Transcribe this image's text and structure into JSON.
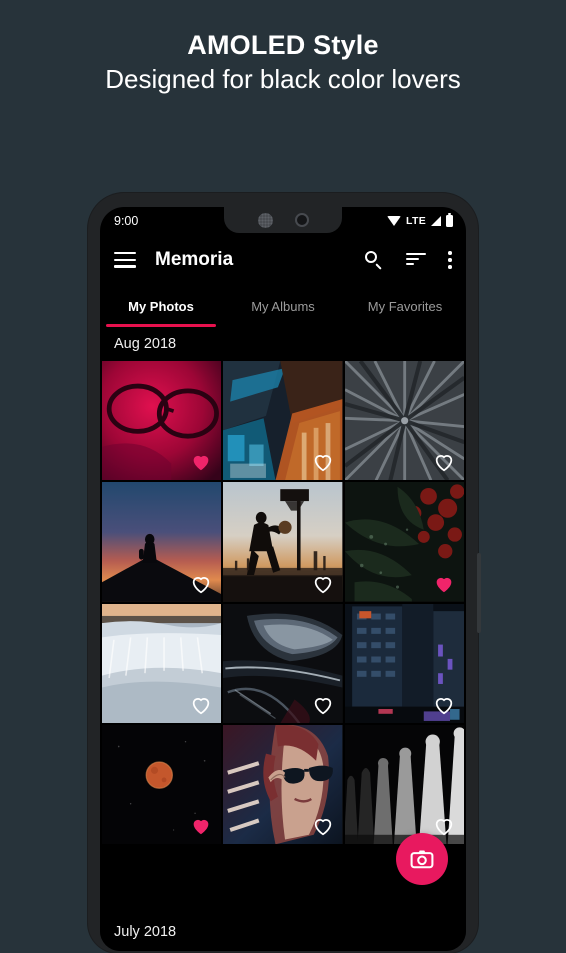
{
  "promo": {
    "headline": "AMOLED Style",
    "subheadline": "Designed for black color lovers"
  },
  "colors": {
    "background": "#27333a",
    "phone_frame": "#222426",
    "screen": "#000000",
    "accent_pink": "#e8114e",
    "fab_pink": "#e8195f",
    "heart_filled": "#f0246a",
    "tab_inactive": "#9b9b9b"
  },
  "status_bar": {
    "time": "9:00",
    "network_label": "LTE",
    "icons": [
      "wifi-icon",
      "lte-label",
      "signal-icon",
      "battery-icon"
    ]
  },
  "app_bar": {
    "menu_icon": "hamburger-menu-icon",
    "title": "Memoria",
    "actions": [
      {
        "name": "search-icon",
        "label": "Search"
      },
      {
        "name": "sort-icon",
        "label": "Sort"
      },
      {
        "name": "overflow-menu-icon",
        "label": "More options"
      }
    ]
  },
  "tabs": [
    {
      "label": "My Photos",
      "active": true
    },
    {
      "label": "My Albums",
      "active": false
    },
    {
      "label": "My Favorites",
      "active": false
    }
  ],
  "sections": [
    {
      "title": "Aug 2018"
    },
    {
      "title": "July 2018"
    }
  ],
  "photos": [
    {
      "id": 1,
      "description": "Portrait with sunglasses in crimson light",
      "favorite": true
    },
    {
      "id": 2,
      "description": "Night market from above with blue and orange lights",
      "favorite": false
    },
    {
      "id": 3,
      "description": "Gray radial palm leaf starburst",
      "favorite": false
    },
    {
      "id": 4,
      "description": "Hiker silhouette on hill at sunset",
      "favorite": false
    },
    {
      "id": 5,
      "description": "Basketball player silhouette at dusk",
      "favorite": false
    },
    {
      "id": 6,
      "description": "Dark red berries and leaves with dew",
      "favorite": true
    },
    {
      "id": 7,
      "description": "Waterfall long exposure at dawn",
      "favorite": false
    },
    {
      "id": 8,
      "description": "Dark abstract car body close-up",
      "favorite": false
    },
    {
      "id": 9,
      "description": "Blue toned city building at night",
      "favorite": false
    },
    {
      "id": 10,
      "description": "Blood moon on black night sky",
      "favorite": true
    },
    {
      "id": 11,
      "description": "Woman with sunglasses in neon light",
      "favorite": false
    },
    {
      "id": 12,
      "description": "Black and white fence posts",
      "favorite": false
    }
  ],
  "fab": {
    "icon": "camera-icon",
    "label": "Take photo"
  }
}
